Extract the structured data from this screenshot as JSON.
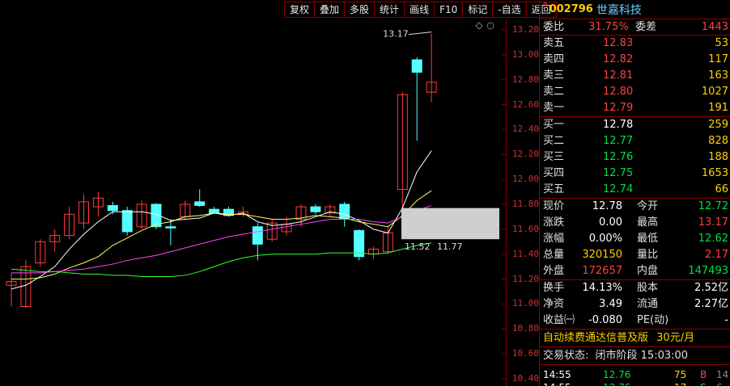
{
  "toolbar": [
    "复权",
    "叠加",
    "多股",
    "统计",
    "画线",
    "F10",
    "标记",
    "-自选",
    "返回"
  ],
  "chart": {
    "y_ticks": [
      "13.20",
      "13.00",
      "12.80",
      "12.60",
      "12.40",
      "12.20",
      "12.00",
      "11.80",
      "11.60",
      "11.40",
      "11.20",
      "11.00",
      "10.80",
      "10.60",
      "10.40"
    ],
    "annot_high": "13.17",
    "annot_low": "11.52",
    "annot_ma": "11.77",
    "candles": [
      {
        "o": 11.15,
        "c": 11.18,
        "h": 11.25,
        "l": 10.98
      },
      {
        "o": 10.98,
        "c": 11.3,
        "h": 11.35,
        "l": 10.97
      },
      {
        "o": 11.33,
        "c": 11.5,
        "h": 11.52,
        "l": 11.3
      },
      {
        "o": 11.5,
        "c": 11.55,
        "h": 11.6,
        "l": 11.42
      },
      {
        "o": 11.55,
        "c": 11.72,
        "h": 11.78,
        "l": 11.52
      },
      {
        "o": 11.65,
        "c": 11.82,
        "h": 11.88,
        "l": 11.6
      },
      {
        "o": 11.78,
        "c": 11.85,
        "h": 11.9,
        "l": 11.7
      },
      {
        "o": 11.79,
        "c": 11.75,
        "h": 11.82,
        "l": 11.72
      },
      {
        "o": 11.75,
        "c": 11.58,
        "h": 11.78,
        "l": 11.55
      },
      {
        "o": 11.62,
        "c": 11.8,
        "h": 11.83,
        "l": 11.6
      },
      {
        "o": 11.8,
        "c": 11.62,
        "h": 11.81,
        "l": 11.6
      },
      {
        "o": 11.62,
        "c": 11.61,
        "h": 11.68,
        "l": 11.47
      },
      {
        "o": 11.7,
        "c": 11.8,
        "h": 11.83,
        "l": 11.68
      },
      {
        "o": 11.82,
        "c": 11.79,
        "h": 11.92,
        "l": 11.78
      },
      {
        "o": 11.76,
        "c": 11.73,
        "h": 11.78,
        "l": 11.72
      },
      {
        "o": 11.76,
        "c": 11.71,
        "h": 11.78,
        "l": 11.7
      },
      {
        "o": 11.72,
        "c": 11.74,
        "h": 11.78,
        "l": 11.7
      },
      {
        "o": 11.62,
        "c": 11.48,
        "h": 11.65,
        "l": 11.35
      },
      {
        "o": 11.52,
        "c": 11.65,
        "h": 11.68,
        "l": 11.5
      },
      {
        "o": 11.58,
        "c": 11.64,
        "h": 11.7,
        "l": 11.55
      },
      {
        "o": 11.68,
        "c": 11.78,
        "h": 11.8,
        "l": 11.62
      },
      {
        "o": 11.78,
        "c": 11.74,
        "h": 11.8,
        "l": 11.72
      },
      {
        "o": 11.73,
        "c": 11.78,
        "h": 11.8,
        "l": 11.7
      },
      {
        "o": 11.8,
        "c": 11.68,
        "h": 11.82,
        "l": 11.62
      },
      {
        "o": 11.59,
        "c": 11.38,
        "h": 11.6,
        "l": 11.35
      },
      {
        "o": 11.4,
        "c": 11.44,
        "h": 11.46,
        "l": 11.36
      },
      {
        "o": 11.42,
        "c": 11.57,
        "h": 11.62,
        "l": 11.4
      },
      {
        "o": 11.92,
        "c": 12.68,
        "h": 12.7,
        "l": 11.77
      },
      {
        "o": 12.96,
        "c": 12.86,
        "h": 12.98,
        "l": 12.31
      },
      {
        "o": 12.7,
        "c": 12.78,
        "h": 13.17,
        "l": 12.62
      }
    ],
    "ma5": [
      11.12,
      11.15,
      11.22,
      11.3,
      11.44,
      11.56,
      11.66,
      11.74,
      11.74,
      11.74,
      11.72,
      11.67,
      11.68,
      11.69,
      11.73,
      11.71,
      11.73,
      11.66,
      11.63,
      11.64,
      11.66,
      11.7,
      11.74,
      11.72,
      11.67,
      11.6,
      11.57,
      11.77,
      12.06,
      12.23
    ],
    "ma10": [
      11.2,
      11.2,
      11.21,
      11.24,
      11.29,
      11.33,
      11.38,
      11.47,
      11.53,
      11.59,
      11.64,
      11.66,
      11.7,
      11.71,
      11.73,
      11.72,
      11.72,
      11.7,
      11.68,
      11.68,
      11.69,
      11.71,
      11.7,
      11.69,
      11.66,
      11.64,
      11.62,
      11.71,
      11.83,
      11.91
    ],
    "ma20": [
      11.25,
      11.25,
      11.25,
      11.26,
      11.27,
      11.28,
      11.3,
      11.32,
      11.35,
      11.37,
      11.39,
      11.42,
      11.45,
      11.48,
      11.51,
      11.54,
      11.56,
      11.58,
      11.6,
      11.62,
      11.64,
      11.66,
      11.68,
      11.68,
      11.68,
      11.66,
      11.65,
      11.7,
      11.75,
      11.79
    ],
    "ma60": [
      11.28,
      11.27,
      11.26,
      11.26,
      11.25,
      11.24,
      11.24,
      11.23,
      11.23,
      11.22,
      11.22,
      11.22,
      11.23,
      11.26,
      11.3,
      11.34,
      11.37,
      11.39,
      11.4,
      11.4,
      11.4,
      11.4,
      11.41,
      11.41,
      11.41,
      11.4,
      11.41,
      11.44,
      11.47,
      11.49
    ]
  },
  "quote": {
    "r_mark": "R",
    "code": "002796",
    "name": "世嘉科技",
    "weibi_label": "委比",
    "weibi": "31.75%",
    "weicha_label": "委差",
    "weicha": "1443",
    "asks": [
      {
        "label": "卖五",
        "price": "12.83",
        "vol": "53"
      },
      {
        "label": "卖四",
        "price": "12.82",
        "vol": "117"
      },
      {
        "label": "卖三",
        "price": "12.81",
        "vol": "163"
      },
      {
        "label": "卖二",
        "price": "12.80",
        "vol": "1027"
      },
      {
        "label": "卖一",
        "price": "12.79",
        "vol": "191"
      }
    ],
    "bids": [
      {
        "label": "买一",
        "price": "12.78",
        "vol": "259"
      },
      {
        "label": "买二",
        "price": "12.77",
        "vol": "828"
      },
      {
        "label": "买三",
        "price": "12.76",
        "vol": "188"
      },
      {
        "label": "买四",
        "price": "12.75",
        "vol": "1653"
      },
      {
        "label": "买五",
        "price": "12.74",
        "vol": "66"
      }
    ],
    "stats": [
      {
        "l1": "现价",
        "v1": "12.78",
        "c1": "white",
        "l2": "今开",
        "v2": "12.72",
        "c2": "green"
      },
      {
        "l1": "涨跌",
        "v1": "0.00",
        "c1": "white",
        "l2": "最高",
        "v2": "13.17",
        "c2": "red"
      },
      {
        "l1": "涨幅",
        "v1": "0.00%",
        "c1": "white",
        "l2": "最低",
        "v2": "12.62",
        "c2": "green"
      },
      {
        "l1": "总量",
        "v1": "320150",
        "c1": "yellow",
        "l2": "量比",
        "v2": "2.17",
        "c2": "red"
      },
      {
        "l1": "外盘",
        "v1": "172657",
        "c1": "red",
        "l2": "内盘",
        "v2": "147493",
        "c2": "green"
      }
    ],
    "fund": [
      {
        "l1": "换手",
        "v1": "14.13%",
        "l2": "股本",
        "v2": "2.52亿"
      },
      {
        "l1": "净资",
        "v1": "3.49",
        "l2": "流通",
        "v2": "2.27亿"
      },
      {
        "l1": "收益㈠",
        "v1": "-0.080",
        "l2": "PE(动)",
        "v2": "-"
      }
    ],
    "promo_text": "自动续费通达信普及版",
    "promo_price": "30元/月",
    "status_label": "交易状态:",
    "status_value": "闭市阶段 15:03:00",
    "ticks": [
      {
        "time": "14:55",
        "price": "12.76",
        "vol": "75",
        "side": "B",
        "n": "14"
      },
      {
        "time": "14:55",
        "price": "12.76",
        "vol": "17",
        "side": "S",
        "n": "6"
      }
    ]
  }
}
